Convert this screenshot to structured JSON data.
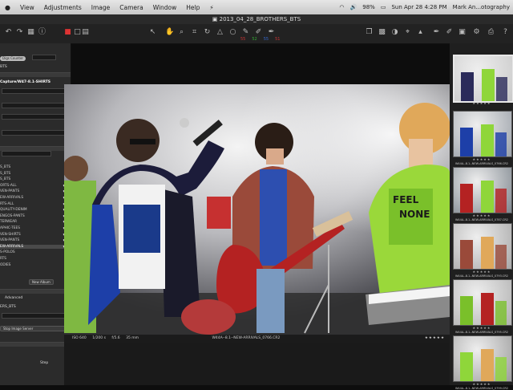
{
  "menubar": {
    "items": [
      "View",
      "Adjustments",
      "Image",
      "Camera",
      "Window",
      "Help"
    ],
    "battery": "98%",
    "datetime": "Sun Apr 28  4:28 PM",
    "user": "Mark An...otography"
  },
  "window": {
    "title": "2013_04_28_BROTHERS_BTS"
  },
  "toolbar": {
    "counts": [
      "55",
      "52",
      "55",
      "51"
    ]
  },
  "sidebar": {
    "top_label": "Digs Counter",
    "bts_label": "BTS",
    "path": "Capture/W47-8.1-SHIRTS",
    "items": [
      {
        "label": "S_BTS"
      },
      {
        "label": "S_BTS"
      },
      {
        "label": "S_BTS"
      },
      {
        "label": "ORTS-ALL"
      },
      {
        "label": "VEN-PANTS"
      },
      {
        "label": "EW-ARRIVALS"
      },
      {
        "label": "RTS-ALL"
      },
      {
        "label": "QUALITY-DENIM"
      },
      {
        "label": "ENGOS-PANTS"
      },
      {
        "label": "TERWEAR"
      },
      {
        "label": "APHIC-TEES"
      },
      {
        "label": "VEN-SHIRTS"
      },
      {
        "label": "VEN-PANTS"
      },
      {
        "label": "EW-ARRIVALS"
      },
      {
        "label": "S-POLOS"
      },
      {
        "label": "RTS"
      },
      {
        "label": "ODIES"
      }
    ],
    "new_album": "New Album",
    "advanced": "Advanced",
    "filter_value": "ERS_BTS",
    "stop_server": "Stop Image Server",
    "step": "Step"
  },
  "info": {
    "iso": "ISO 640",
    "shutter": "1/200 s",
    "aperture": "f/5.6",
    "focal": "35 mm",
    "filename": "W44A--8.1--NEW-ARRIVALS_0766.CR2"
  },
  "filmstrip": [
    {
      "label": ""
    },
    {
      "label": "W44A--8.1--NEW-ARRIVALS_0766.CR2"
    },
    {
      "label": "W44A--8.1--NEW-ARRIVALS_0787.CR2"
    },
    {
      "label": "W44A--8.1--NEW-ARRIVALS_0793.CR2"
    },
    {
      "label": "W44A--8.1--NEW-ARRIVALS_0795.CR2"
    },
    {
      "label": "W44A--8.1--NEW-ARRIVALS_0799.CR2"
    }
  ],
  "photo_text": {
    "shirt_line1": "FEEL",
    "shirt_line2": "NONE"
  },
  "colors": {
    "accent": "#c63030"
  }
}
